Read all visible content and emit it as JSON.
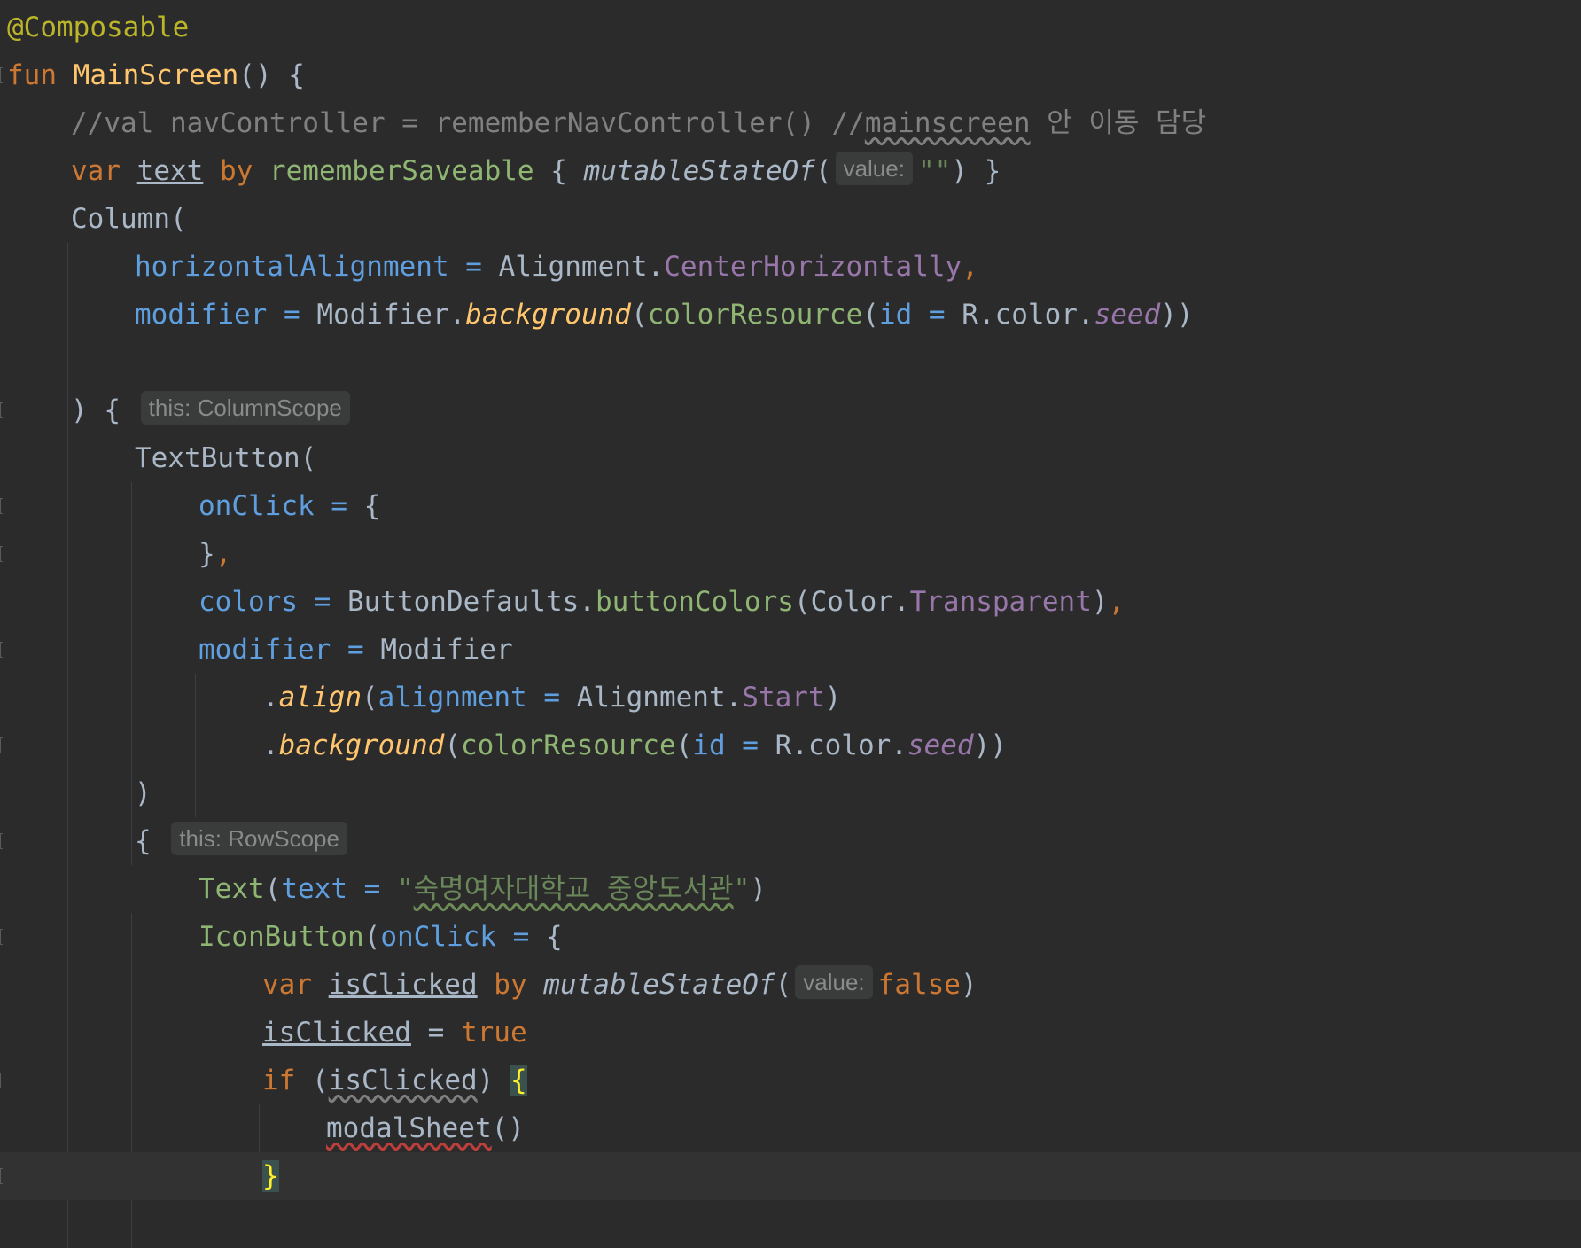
{
  "editor": {
    "lines": [
      {
        "indent": 0,
        "tokens": [
          {
            "t": "@Composable",
            "c": "ann"
          }
        ]
      },
      {
        "indent": 0,
        "marker": true,
        "tokens": [
          {
            "t": "fun ",
            "c": "kw"
          },
          {
            "t": "MainScreen",
            "c": "fn"
          },
          {
            "t": "() {",
            "c": "id"
          }
        ]
      },
      {
        "indent": 1,
        "tokens": [
          {
            "t": "//val navController = rememberNavController() //",
            "c": "cm"
          },
          {
            "t": "mainscreen",
            "c": "cm wavy-grey"
          },
          {
            "t": " 안 이동 담당",
            "c": "cm"
          }
        ]
      },
      {
        "indent": 1,
        "tokens": [
          {
            "t": "var ",
            "c": "kw"
          },
          {
            "t": "text",
            "c": "id underline"
          },
          {
            "t": " by ",
            "c": "kw"
          },
          {
            "t": "rememberSaveable",
            "c": "callgreen"
          },
          {
            "t": " { ",
            "c": "id"
          },
          {
            "t": "mutableStateOf",
            "c": "id italic"
          },
          {
            "t": "(",
            "c": "id"
          },
          {
            "t": "value:",
            "c": "hint"
          },
          {
            "t": "\"\"",
            "c": "str"
          },
          {
            "t": ") }",
            "c": "id"
          }
        ]
      },
      {
        "indent": 1,
        "tokens": [
          {
            "t": "Column(",
            "c": "id"
          }
        ]
      },
      {
        "indent": 2,
        "tokens": [
          {
            "t": "horizontalAlignment",
            "c": "param"
          },
          {
            "t": " = ",
            "c": "op"
          },
          {
            "t": "Alignment.",
            "c": "id"
          },
          {
            "t": "CenterHorizontally",
            "c": "prop"
          },
          {
            "t": ",",
            "c": "kw"
          }
        ]
      },
      {
        "indent": 2,
        "tokens": [
          {
            "t": "modifier",
            "c": "param"
          },
          {
            "t": " = ",
            "c": "op"
          },
          {
            "t": "Modifier.",
            "c": "id"
          },
          {
            "t": "background",
            "c": "fni"
          },
          {
            "t": "(",
            "c": "id"
          },
          {
            "t": "colorResource",
            "c": "callgreen"
          },
          {
            "t": "(",
            "c": "id"
          },
          {
            "t": "id",
            "c": "param"
          },
          {
            "t": " = ",
            "c": "op"
          },
          {
            "t": "R.color.",
            "c": "id"
          },
          {
            "t": "seed",
            "c": "propi"
          },
          {
            "t": "))",
            "c": "id"
          }
        ]
      },
      {
        "indent": 0,
        "tokens": []
      },
      {
        "indent": 1,
        "marker": true,
        "tokens": [
          {
            "t": ") { ",
            "c": "id"
          },
          {
            "t": "this: ColumnScope",
            "c": "hint"
          }
        ]
      },
      {
        "indent": 2,
        "tokens": [
          {
            "t": "TextButton(",
            "c": "id"
          }
        ]
      },
      {
        "indent": 3,
        "marker": true,
        "tokens": [
          {
            "t": "onClick",
            "c": "param"
          },
          {
            "t": " = ",
            "c": "op"
          },
          {
            "t": "{",
            "c": "id"
          }
        ]
      },
      {
        "indent": 3,
        "marker": true,
        "tokens": [
          {
            "t": "}",
            "c": "id"
          },
          {
            "t": ",",
            "c": "kw"
          }
        ]
      },
      {
        "indent": 3,
        "tokens": [
          {
            "t": "colors",
            "c": "param"
          },
          {
            "t": " = ",
            "c": "op"
          },
          {
            "t": "ButtonDefaults.",
            "c": "id"
          },
          {
            "t": "buttonColors",
            "c": "callgreen"
          },
          {
            "t": "(Color.",
            "c": "id"
          },
          {
            "t": "Transparent",
            "c": "prop"
          },
          {
            "t": ")",
            "c": "id"
          },
          {
            "t": ",",
            "c": "kw"
          }
        ]
      },
      {
        "indent": 3,
        "marker": true,
        "tokens": [
          {
            "t": "modifier",
            "c": "param"
          },
          {
            "t": " = ",
            "c": "op"
          },
          {
            "t": "Modifier",
            "c": "id"
          }
        ]
      },
      {
        "indent": 4,
        "tokens": [
          {
            "t": ".",
            "c": "id"
          },
          {
            "t": "align",
            "c": "fni"
          },
          {
            "t": "(",
            "c": "id"
          },
          {
            "t": "alignment",
            "c": "param"
          },
          {
            "t": " = ",
            "c": "op"
          },
          {
            "t": "Alignment.",
            "c": "id"
          },
          {
            "t": "Start",
            "c": "prop"
          },
          {
            "t": ")",
            "c": "id"
          }
        ]
      },
      {
        "indent": 4,
        "marker": true,
        "tokens": [
          {
            "t": ".",
            "c": "id"
          },
          {
            "t": "background",
            "c": "fni"
          },
          {
            "t": "(",
            "c": "id"
          },
          {
            "t": "colorResource",
            "c": "callgreen"
          },
          {
            "t": "(",
            "c": "id"
          },
          {
            "t": "id",
            "c": "param"
          },
          {
            "t": " = ",
            "c": "op"
          },
          {
            "t": "R.color.",
            "c": "id"
          },
          {
            "t": "seed",
            "c": "propi"
          },
          {
            "t": "))",
            "c": "id"
          }
        ]
      },
      {
        "indent": 2,
        "tokens": [
          {
            "t": ")",
            "c": "id"
          }
        ]
      },
      {
        "indent": 2,
        "marker": true,
        "tokens": [
          {
            "t": "{ ",
            "c": "id"
          },
          {
            "t": "this: RowScope",
            "c": "hint"
          }
        ]
      },
      {
        "indent": 3,
        "tokens": [
          {
            "t": "Text",
            "c": "callgreen"
          },
          {
            "t": "(",
            "c": "id"
          },
          {
            "t": "text",
            "c": "param"
          },
          {
            "t": " = ",
            "c": "op"
          },
          {
            "t": "\"",
            "c": "str"
          },
          {
            "t": "숙명여자대학교 중앙도서관",
            "c": "str wavy"
          },
          {
            "t": "\"",
            "c": "str"
          },
          {
            "t": ")",
            "c": "id"
          }
        ]
      },
      {
        "indent": 3,
        "marker": true,
        "tokens": [
          {
            "t": "IconButton",
            "c": "callgreen"
          },
          {
            "t": "(",
            "c": "id"
          },
          {
            "t": "onClick",
            "c": "param"
          },
          {
            "t": " = ",
            "c": "op"
          },
          {
            "t": "{",
            "c": "id"
          }
        ]
      },
      {
        "indent": 4,
        "tokens": [
          {
            "t": "var ",
            "c": "kw"
          },
          {
            "t": "isClicked",
            "c": "id underline"
          },
          {
            "t": " by ",
            "c": "kw"
          },
          {
            "t": "mutableStateOf",
            "c": "id italic"
          },
          {
            "t": "(",
            "c": "id"
          },
          {
            "t": "value:",
            "c": "hint"
          },
          {
            "t": "false",
            "c": "kw"
          },
          {
            "t": ")",
            "c": "id"
          }
        ]
      },
      {
        "indent": 4,
        "tokens": [
          {
            "t": "isClicked",
            "c": "id underline"
          },
          {
            "t": " = ",
            "c": "id"
          },
          {
            "t": "true",
            "c": "kw"
          }
        ]
      },
      {
        "indent": 4,
        "marker": true,
        "tokens": [
          {
            "t": "if ",
            "c": "kw"
          },
          {
            "t": "(",
            "c": "id"
          },
          {
            "t": "isClicked",
            "c": "id wavy-grey"
          },
          {
            "t": ") ",
            "c": "id"
          },
          {
            "t": "{",
            "c": "brace-hl"
          }
        ]
      },
      {
        "indent": 5,
        "tokens": [
          {
            "t": "modalSheet",
            "c": "id wavy-red"
          },
          {
            "t": "()",
            "c": "id"
          }
        ]
      },
      {
        "indent": 4,
        "marker": true,
        "current": true,
        "tokens": [
          {
            "t": "}",
            "c": "brace-hl"
          }
        ]
      }
    ]
  }
}
